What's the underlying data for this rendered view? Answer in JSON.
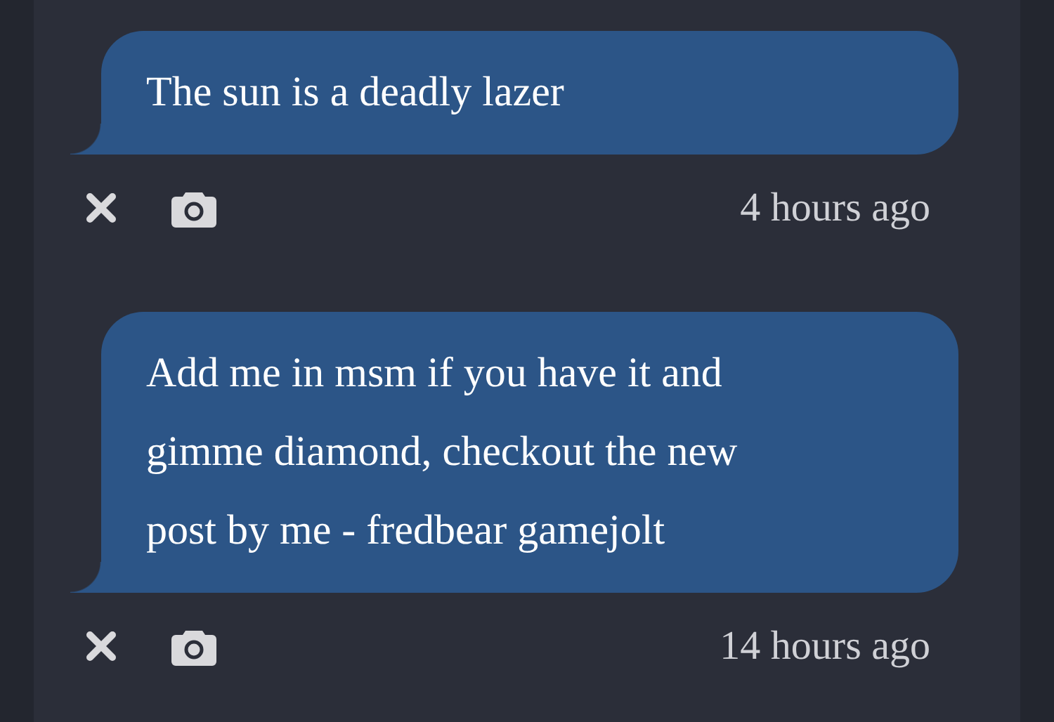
{
  "messages": [
    {
      "text": "The sun is a deadly lazer",
      "time": "4 hours ago"
    },
    {
      "text": "Add me in msm if you have it and gimme diamond, checkout the new post by me - fredbear gamejolt",
      "time": "14 hours ago"
    }
  ]
}
